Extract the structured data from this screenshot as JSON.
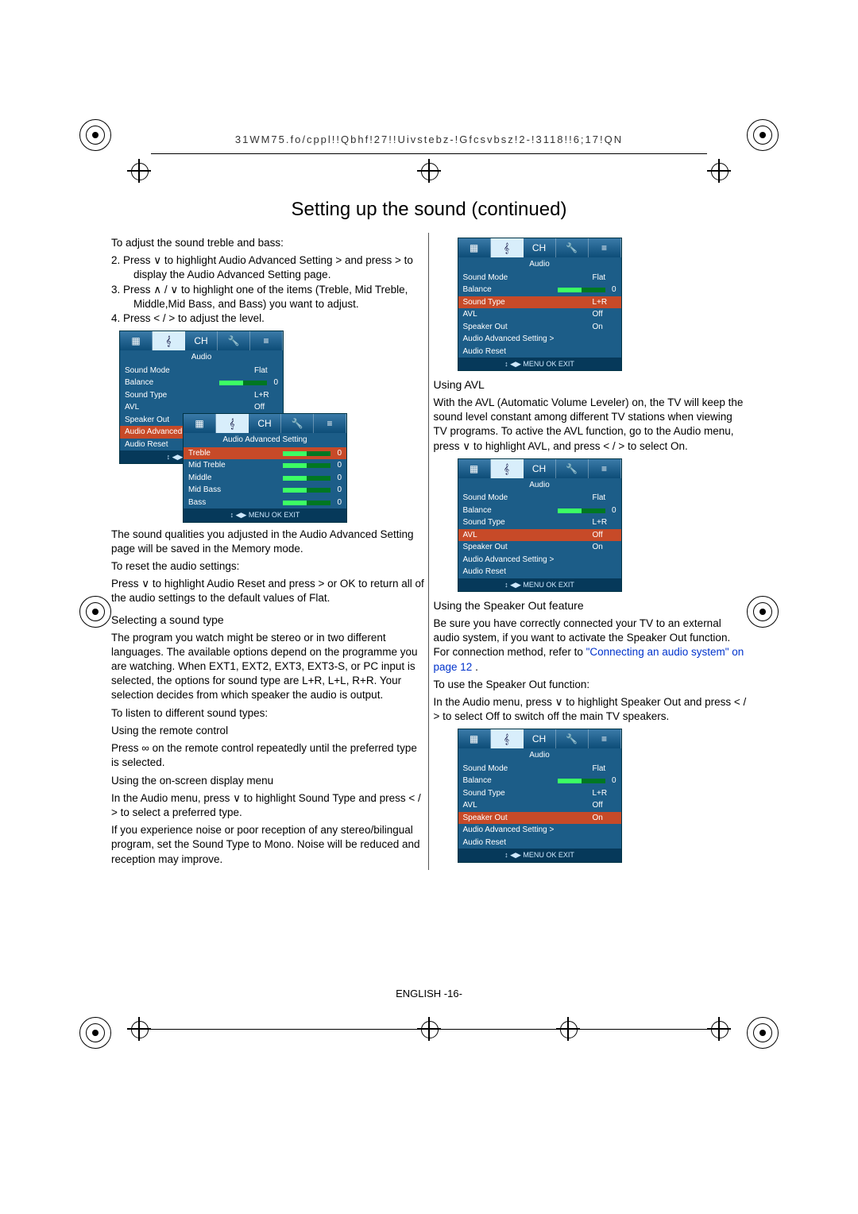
{
  "header_code": "31WM75.fo/cppl!!Qbhf!27!!Uivstebz-!Gfcsvbsz!2-!3118!!6;17!QN",
  "title": "Setting up the sound (continued)",
  "left": {
    "intro": "To adjust the sound treble and bass:",
    "steps": [
      "2.   Press ∨ to highlight Audio Advanced Setting > and press > to display the Audio Advanced Setting page.",
      "3.   Press ∧ / ∨ to highlight one of the items (Treble, Mid Treble, Middle,Mid Bass, and Bass) you want to adjust.",
      "4.   Press < / > to adjust the level."
    ],
    "after_osd": "The sound qualities you adjusted in the Audio Advanced Setting page will be saved in the Memory mode.",
    "reset_h": "To reset the audio settings:",
    "reset_t": "Press ∨ to highlight Audio Reset and press > or OK to return all of the audio settings to the default values of Flat.",
    "sel_h": "Selecting a sound type",
    "sel_p1": "The program you watch might be stereo or in two different languages. The available options depend on the programme you are watching. When EXT1, EXT2, EXT3, EXT3-S, or PC input is selected, the options for sound type are L+R, L+L, R+R. Your selection decides from which speaker the audio is output.",
    "listen_h": "To listen to different sound types:",
    "remote_h": "Using the remote control",
    "remote_t": "Press ∞       on the remote control repeatedly until the preferred type is selected.",
    "osd_h": "Using the on-screen display menu",
    "osd_t": "In the Audio menu, press ∨ to highlight Sound Type and press < / > to select a preferred type.",
    "noise_t": "If you experience noise or poor reception of any stereo/bilingual program, set the Sound Type to Mono. Noise will be reduced and reception may improve."
  },
  "right": {
    "avl_h": "Using AVL",
    "avl_t": "With the AVL (Automatic Volume Leveler) on, the TV will keep the sound level constant among different TV stations when viewing TV programs. To active the AVL function, go to the Audio menu, press ∨ to highlight AVL, and press < / > to select On.",
    "spk_h": "Using the Speaker Out feature",
    "spk_t1a": "Be sure you have correctly connected your TV to an external audio system, if you want to activate the Speaker Out function. For connection method, refer to ",
    "spk_link": "\"Connecting an audio system\" on page 12",
    "spk_t1b": " .",
    "spk_use_h": "To use the Speaker Out function:",
    "spk_use_t": "In the Audio menu, press ∨ to highlight Speaker Out and press < / > to select Off to switch off the main TV speakers."
  },
  "osd": {
    "tabs": [
      "picture",
      "audio",
      "channel",
      "setup",
      "tools"
    ],
    "audio_label": "Audio",
    "rows": {
      "sound_mode": {
        "k": "Sound Mode",
        "v": "Flat"
      },
      "balance": {
        "k": "Balance",
        "v": "0"
      },
      "sound_type": {
        "k": "Sound Type",
        "v": "L+R"
      },
      "avl": {
        "k": "AVL",
        "v": "Off"
      },
      "speaker": {
        "k": "Speaker Out",
        "v": "On"
      },
      "adv": {
        "k": "Audio Advanced Setting >"
      },
      "reset": {
        "k": "Audio Reset"
      }
    },
    "footer": "↕  ◀▶ MENU OK EXIT",
    "adv_title": "Audio Advanced Setting",
    "adv_rows": [
      {
        "k": "Treble",
        "v": "0"
      },
      {
        "k": "Mid Treble",
        "v": "0"
      },
      {
        "k": "Middle",
        "v": "0"
      },
      {
        "k": "Mid Bass",
        "v": "0"
      },
      {
        "k": "Bass",
        "v": "0"
      }
    ]
  },
  "footer": "ENGLISH -16-"
}
